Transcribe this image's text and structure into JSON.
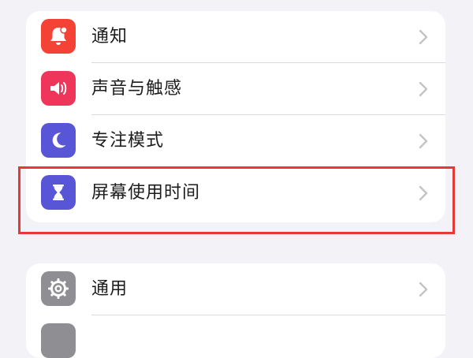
{
  "groups": [
    {
      "items": [
        {
          "label": "通知",
          "icon": "bell-icon",
          "color": "#f44336"
        },
        {
          "label": "声音与触感",
          "icon": "speaker-icon",
          "color": "#f0355b"
        },
        {
          "label": "专注模式",
          "icon": "moon-icon",
          "color": "#5856d6"
        },
        {
          "label": "屏幕使用时间",
          "icon": "hourglass-icon",
          "color": "#5856d6"
        }
      ]
    },
    {
      "items": [
        {
          "label": "通用",
          "icon": "gear-icon",
          "color": "#8e8e93"
        },
        {
          "label": "",
          "icon": "control-center-icon",
          "color": "#8e8e93"
        }
      ]
    }
  ],
  "highlight": {
    "target": "屏幕使用时间",
    "color": "#e53935"
  }
}
